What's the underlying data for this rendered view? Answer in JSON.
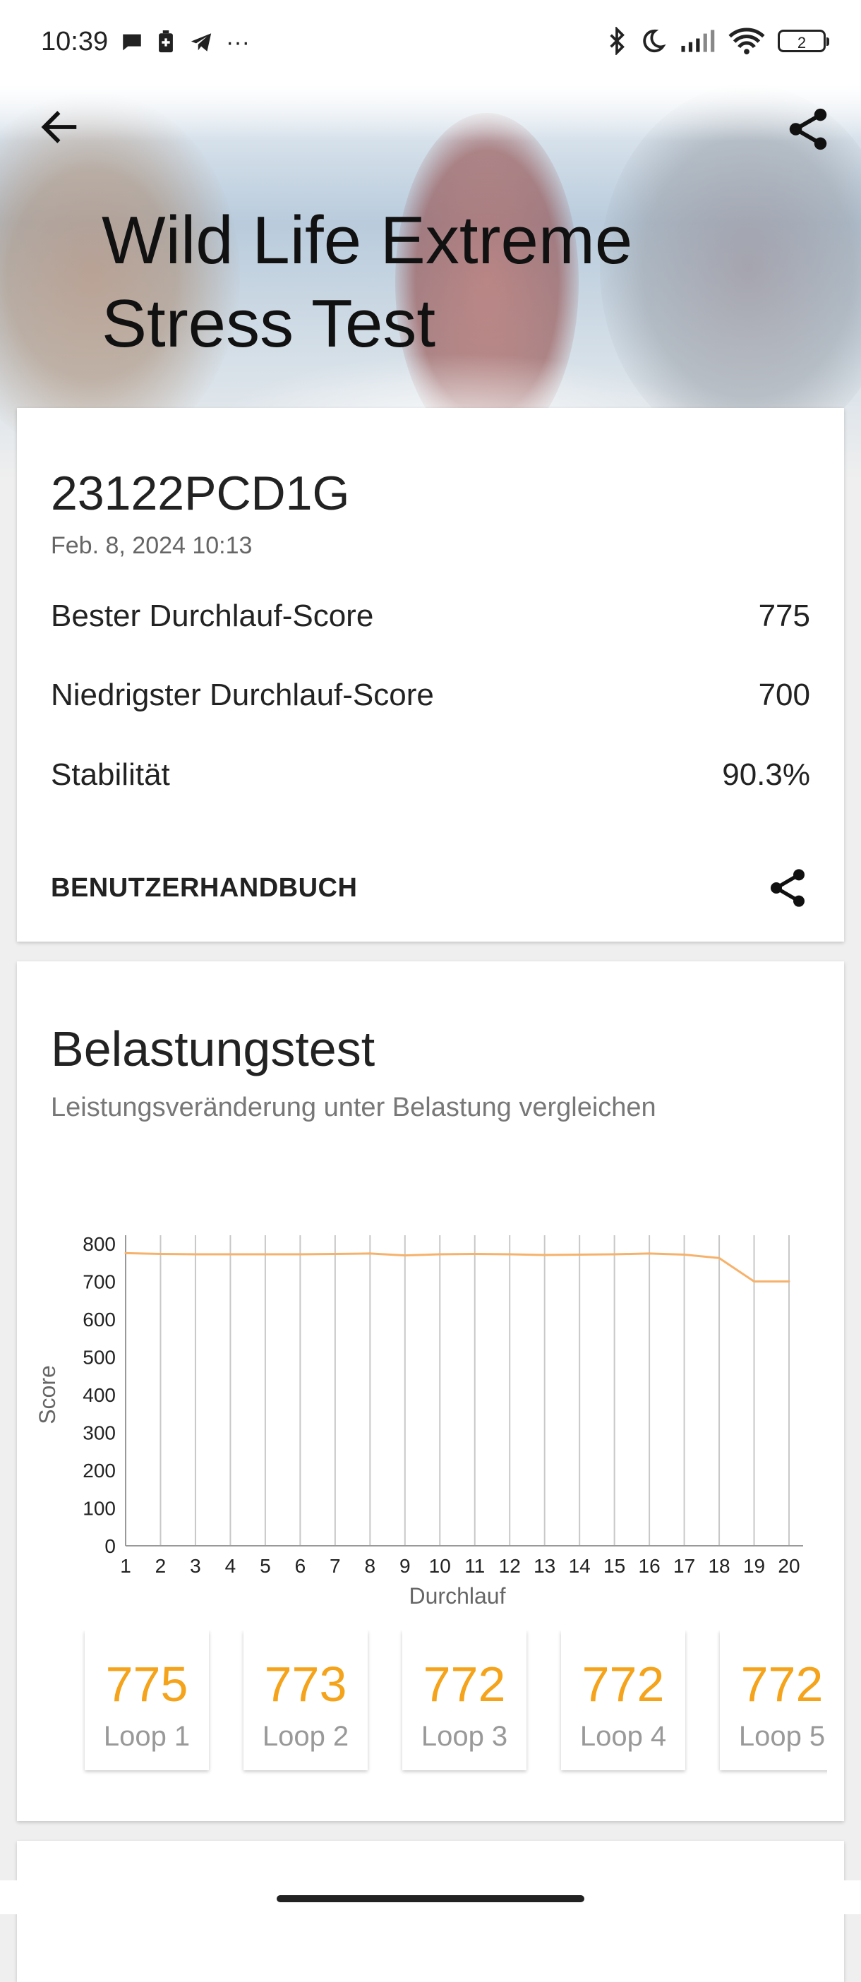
{
  "status_bar": {
    "time": "10:39",
    "left_icons": [
      "message-icon",
      "battery-saver-icon",
      "telegram-icon",
      "more-dots-icon"
    ],
    "right_icons": [
      "bluetooth-icon",
      "moon-icon",
      "signal-icon",
      "wifi-icon",
      "battery-icon"
    ],
    "battery_level": "2"
  },
  "header": {
    "title_line1": "Wild Life Extreme",
    "title_line2": "Stress Test"
  },
  "result": {
    "device": "23122PCD1G",
    "date": "Feb. 8, 2024 10:13",
    "rows": [
      {
        "label": "Bester Durchlauf-Score",
        "value": "775"
      },
      {
        "label": "Niedrigster Durchlauf-Score",
        "value": "700"
      },
      {
        "label": "Stabilität",
        "value": "90.3%"
      }
    ],
    "manual_label": "BENUTZERHANDBUCH"
  },
  "stress": {
    "title": "Belastungstest",
    "subtitle": "Leistungsveränderung unter Belastung vergleichen"
  },
  "chart_data": {
    "type": "line",
    "xlabel": "Durchlauf",
    "ylabel": "Score",
    "x": [
      1,
      2,
      3,
      4,
      5,
      6,
      7,
      8,
      9,
      10,
      11,
      12,
      13,
      14,
      15,
      16,
      17,
      18,
      19,
      20
    ],
    "series": [
      {
        "values": [
          775,
          773,
          772,
          772,
          772,
          772,
          773,
          774,
          769,
          772,
          773,
          772,
          770,
          771,
          772,
          774,
          771,
          762,
          700,
          700
        ]
      }
    ],
    "ylim": [
      0,
      800
    ],
    "yticks": [
      0,
      100,
      200,
      300,
      400,
      500,
      600,
      700,
      800
    ],
    "grid": "vertical",
    "line_color": "#f6b26b"
  },
  "loops": [
    {
      "score": "775",
      "label": "Loop 1"
    },
    {
      "score": "773",
      "label": "Loop 2"
    },
    {
      "score": "772",
      "label": "Loop 3"
    },
    {
      "score": "772",
      "label": "Loop 4"
    },
    {
      "score": "772",
      "label": "Loop 5"
    }
  ],
  "colors": {
    "accent": "#f4a31a",
    "line": "#f6b26b"
  }
}
